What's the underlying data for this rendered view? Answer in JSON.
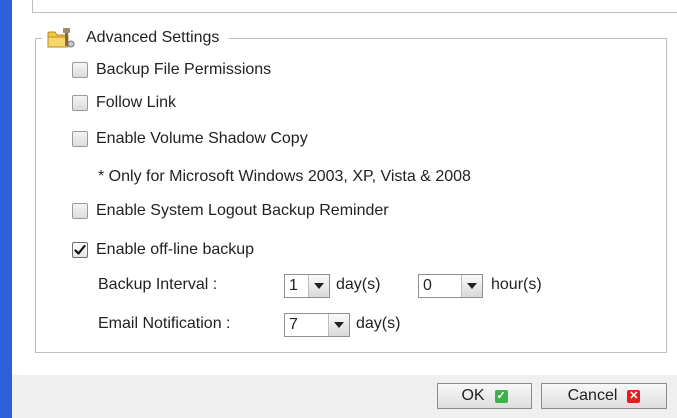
{
  "advanced": {
    "title": "Advanced Settings",
    "icon": "folder-settings-icon",
    "options": [
      {
        "label": "Backup File Permissions",
        "checked": false
      },
      {
        "label": "Follow Link",
        "checked": false
      },
      {
        "label": "Enable Volume Shadow Copy",
        "checked": false
      },
      {
        "label": "Enable System Logout Backup Reminder",
        "checked": false
      },
      {
        "label": "Enable off-line backup",
        "checked": true
      }
    ],
    "shadow_copy_note": "* Only for Microsoft Windows 2003, XP, Vista & 2008",
    "backup_interval": {
      "label": "Backup Interval :",
      "days_value": "1",
      "days_unit": "day(s)",
      "hours_value": "0",
      "hours_unit": "hour(s)"
    },
    "email_notification": {
      "label": "Email Notification :",
      "days_value": "7",
      "days_unit": "day(s)"
    }
  },
  "buttons": {
    "ok_label": "OK",
    "cancel_label": "Cancel"
  },
  "colors": {
    "accent_border": "#2b60d8",
    "ok_icon": "#3bb34a",
    "cancel_icon": "#e02020"
  }
}
